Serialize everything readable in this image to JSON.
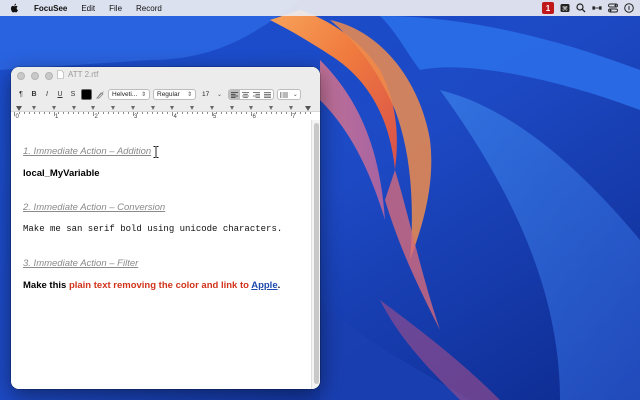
{
  "menubar": {
    "app_name": "FocuSee",
    "items": [
      "Edit",
      "File",
      "Record"
    ],
    "status": {
      "badge_text": "1",
      "icons": [
        "keyboard-icon",
        "search-icon",
        "display-icon",
        "control-center-icon",
        "siri-icon"
      ]
    }
  },
  "window": {
    "title": "ATT 2.rtf",
    "toolbar": {
      "paragraph_style": "¶",
      "bold": "B",
      "italic": "I",
      "underline": "U",
      "strike": "S",
      "text_color": "#000000",
      "font_family": "Helveti...",
      "font_weight": "Regular",
      "font_size": "17"
    },
    "ruler": {
      "numbers": [
        "0",
        "1",
        "2",
        "3",
        "4",
        "5",
        "6",
        "7"
      ]
    }
  },
  "document": {
    "heading1": "1. Immediate Action – Addition",
    "variable": "local_MyVariable",
    "heading2": "2. Immediate Action – Conversion",
    "mono_text": "Make me san serif bold using unicode characters.",
    "heading3": "3. Immediate Action – Filter",
    "rich": {
      "part1": "Make this ",
      "red_part": "plain text removing the color and link to ",
      "link_text": "Apple",
      "end": "."
    }
  },
  "colors": {
    "heading_gray": "#8a8a8a",
    "red_text": "#d1331a",
    "link_blue": "#1c49ac",
    "badge_red": "#c0181a"
  }
}
